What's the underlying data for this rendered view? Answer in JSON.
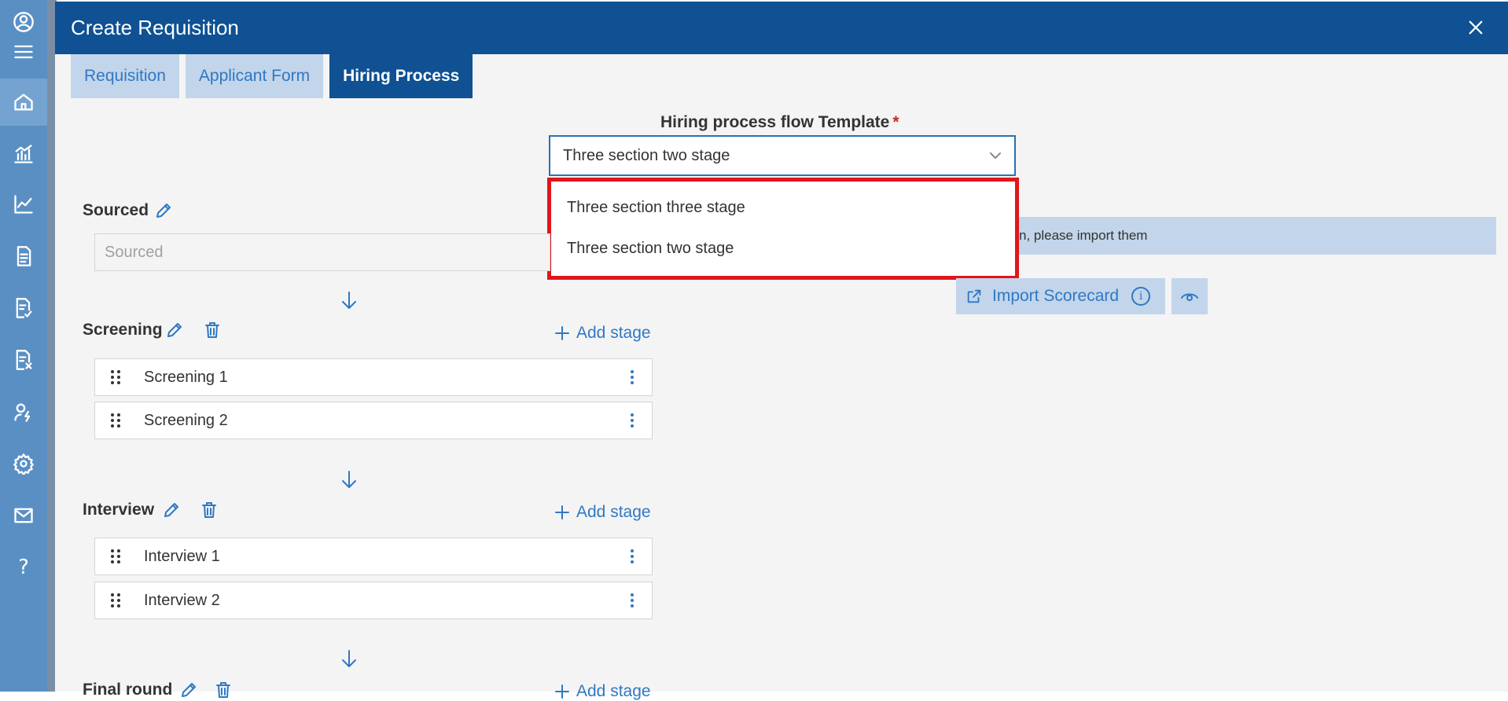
{
  "rail": {
    "items": [
      {
        "name": "profile",
        "icon": "user-circle-icon"
      },
      {
        "name": "menu",
        "icon": "hamburger-icon"
      },
      {
        "name": "home",
        "icon": "home-icon"
      },
      {
        "name": "analytics",
        "icon": "bar-chart-icon"
      },
      {
        "name": "trends",
        "icon": "line-chart-icon"
      },
      {
        "name": "documents",
        "icon": "document-icon"
      },
      {
        "name": "approvals",
        "icon": "document-check-icon"
      },
      {
        "name": "rejected",
        "icon": "document-x-icon"
      },
      {
        "name": "people",
        "icon": "person-flash-icon"
      },
      {
        "name": "settings",
        "icon": "gear-icon"
      },
      {
        "name": "mail",
        "icon": "mail-icon"
      },
      {
        "name": "help",
        "label": "?"
      }
    ]
  },
  "modal": {
    "title": "Create Requisition",
    "tabs": [
      {
        "label": "Requisition",
        "active": false
      },
      {
        "label": "Applicant Form",
        "active": false
      },
      {
        "label": "Hiring Process",
        "active": true
      }
    ]
  },
  "template": {
    "label": "Hiring process flow Template",
    "required_mark": "*",
    "selected": "Three section two stage",
    "options": [
      "Three section three stage",
      "Three section two stage"
    ]
  },
  "scorecard": {
    "info_text": "n, please import them",
    "import_label": "Import Scorecard"
  },
  "sections": {
    "sourced": {
      "title": "Sourced",
      "placeholder": "Sourced"
    },
    "screening": {
      "title": "Screening",
      "add_label": "Add stage",
      "stages": [
        "Screening 1",
        "Screening 2"
      ]
    },
    "interview": {
      "title": "Interview",
      "add_label": "Add stage",
      "stages": [
        "Interview 1",
        "Interview 2"
      ]
    },
    "final": {
      "title": "Final round",
      "add_label": "Add stage"
    }
  },
  "colors": {
    "brand": "#0f5192",
    "accent": "#2f78c4",
    "highlight": "#e0161b"
  }
}
